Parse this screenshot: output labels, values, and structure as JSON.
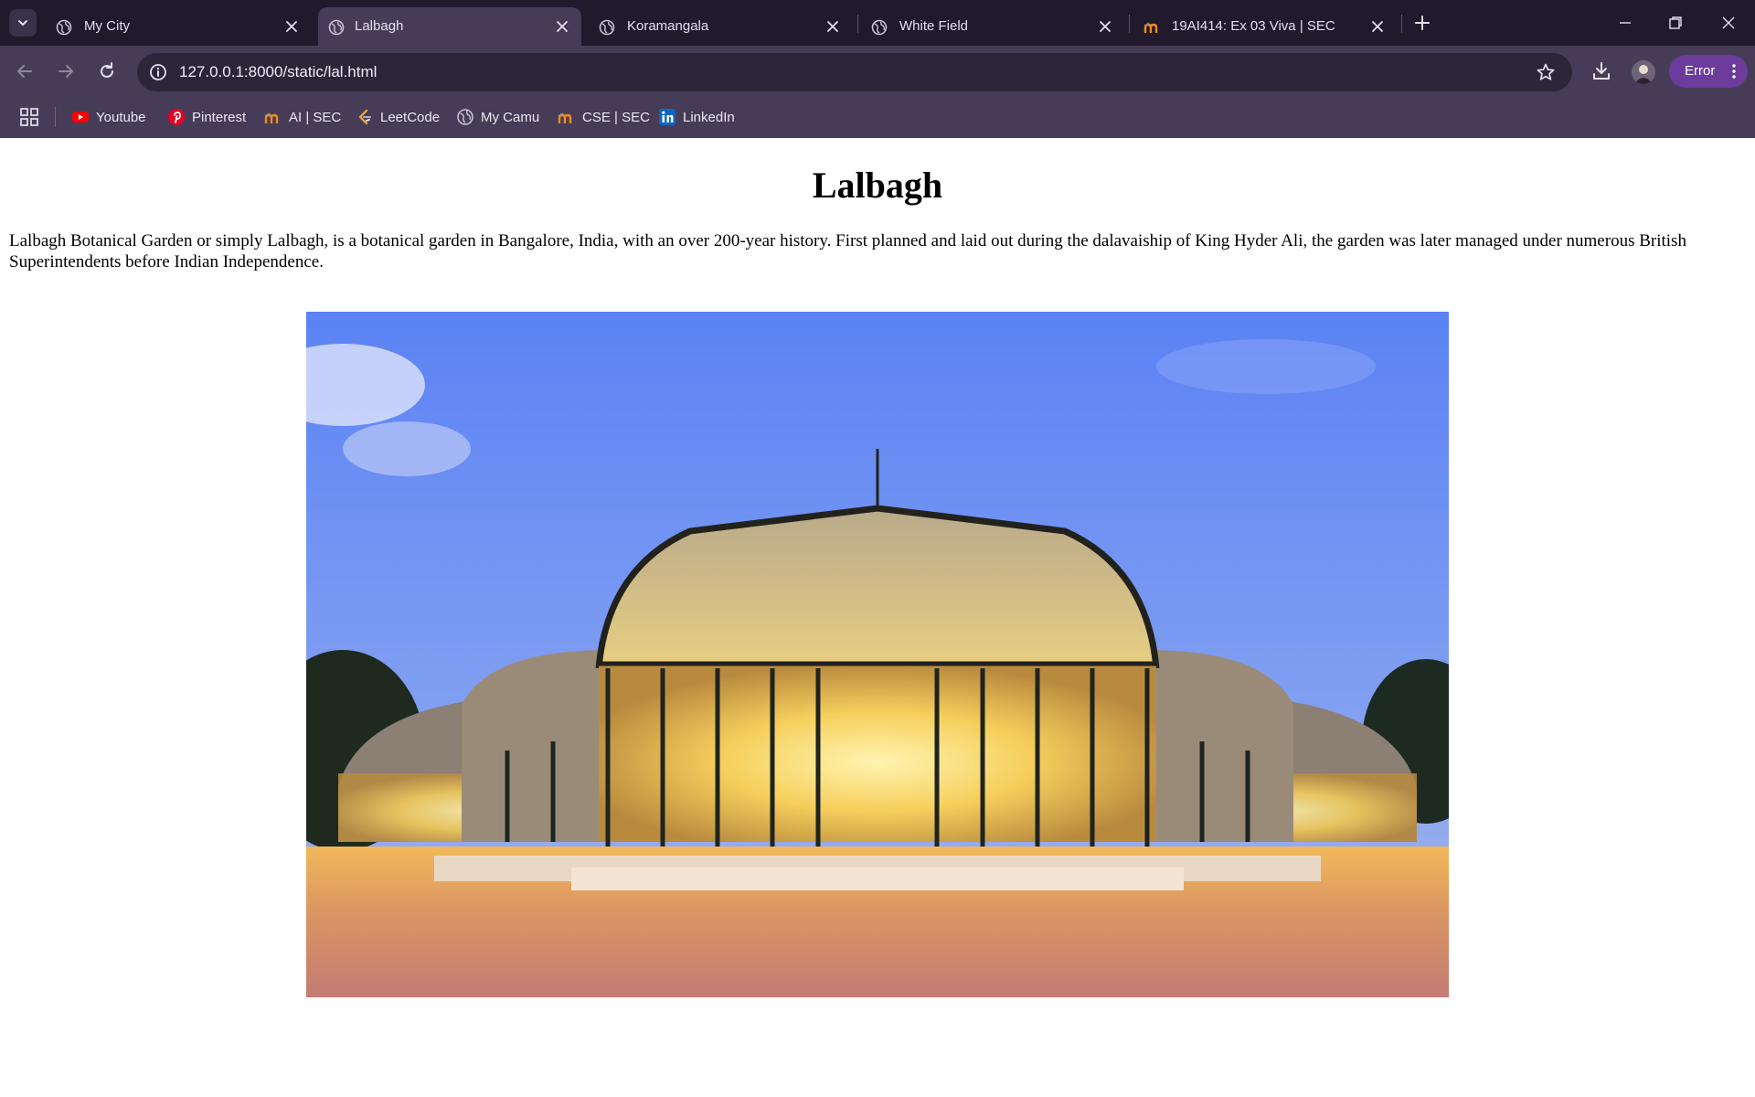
{
  "browser": {
    "tabs": [
      {
        "title": "My City",
        "favicon": "globe-icon",
        "active": false
      },
      {
        "title": "Lalbagh",
        "favicon": "globe-icon",
        "active": true
      },
      {
        "title": "Koramangala",
        "favicon": "globe-icon",
        "active": false
      },
      {
        "title": "White Field",
        "favicon": "globe-icon",
        "active": false
      },
      {
        "title": "19AI414: Ex 03 Viva | SEC",
        "favicon": "moodle-icon",
        "active": false
      }
    ],
    "address_bar": {
      "url": "127.0.0.1:8000/static/lal.html"
    },
    "profile": {
      "status_label": "Error"
    },
    "bookmarks": [
      {
        "label": "Youtube",
        "icon": "youtube-icon"
      },
      {
        "label": "Pinterest",
        "icon": "pinterest-icon"
      },
      {
        "label": "AI | SEC",
        "icon": "moodle-icon"
      },
      {
        "label": "LeetCode",
        "icon": "leetcode-icon"
      },
      {
        "label": "My Camu",
        "icon": "globe-icon"
      },
      {
        "label": "CSE | SEC",
        "icon": "moodle-icon"
      },
      {
        "label": "LinkedIn",
        "icon": "linkedin-icon"
      }
    ],
    "colors": {
      "tab_strip": "#201a2c",
      "toolbar": "#463c57",
      "omnibox": "#2d2538",
      "error_pill": "#6b3c9c"
    }
  },
  "page": {
    "title": "Lalbagh",
    "description": "Lalbagh Botanical Garden or simply Lalbagh, is a botanical garden in Bangalore, India, with an over 200-year history. First planned and laid out during the dalavaiship of King Hyder Ali, the garden was later managed under numerous British Superintendents before Indian Independence."
  }
}
